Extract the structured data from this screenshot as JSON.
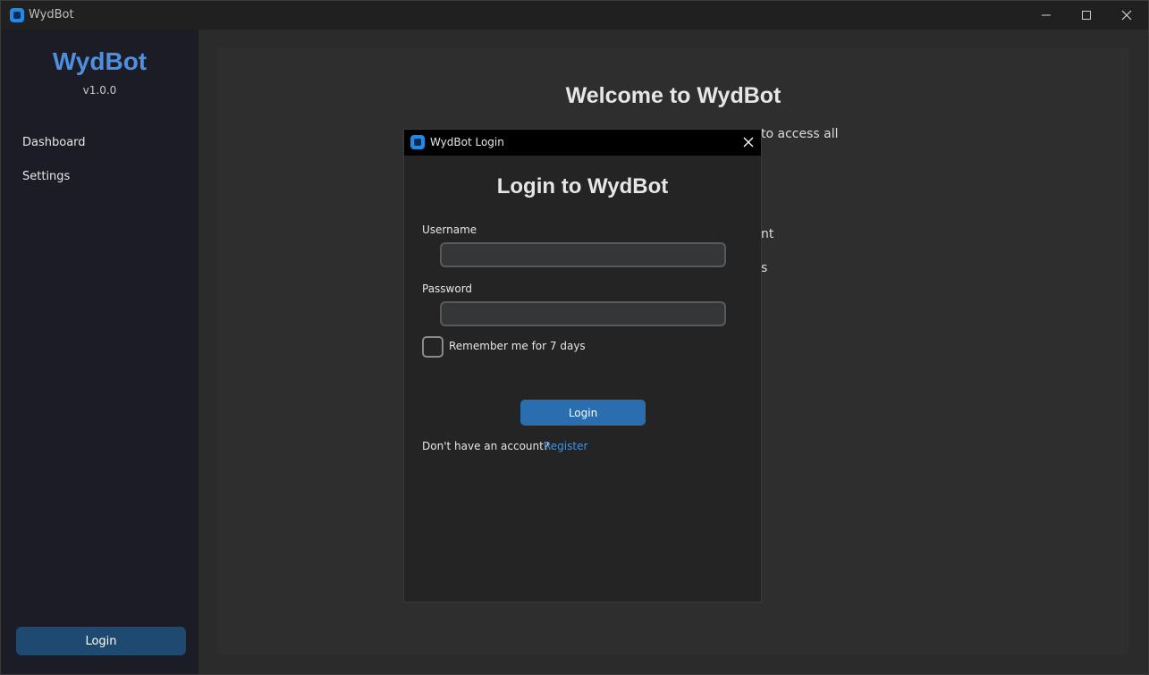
{
  "window": {
    "title": "WydBot"
  },
  "sidebar": {
    "brand": "WydBot",
    "version": "v1.0.0",
    "items": [
      {
        "label": "Dashboard"
      },
      {
        "label": "Settings"
      }
    ],
    "login_label": "Login"
  },
  "main": {
    "welcome_title": "Welcome to WydBot",
    "visible_fragments": [
      "to access all",
      "nt",
      "s"
    ]
  },
  "dialog": {
    "title": "WydBot Login",
    "heading": "Login to WydBot",
    "username_label": "Username",
    "username_value": "",
    "password_label": "Password",
    "password_value": "",
    "remember_label": "Remember me for 7 days",
    "remember_checked": false,
    "login_label": "Login",
    "no_account_text": "Don't have an account?",
    "register_label": "Register"
  },
  "colors": {
    "accent": "#4f8fe0",
    "button": "#2a6eb0",
    "sidebar_button": "#1e4a72",
    "link": "#4a90d9"
  },
  "icons": {
    "app": "app-logo-icon",
    "minimize": "minimize-icon",
    "maximize": "maximize-icon",
    "close": "close-icon"
  }
}
